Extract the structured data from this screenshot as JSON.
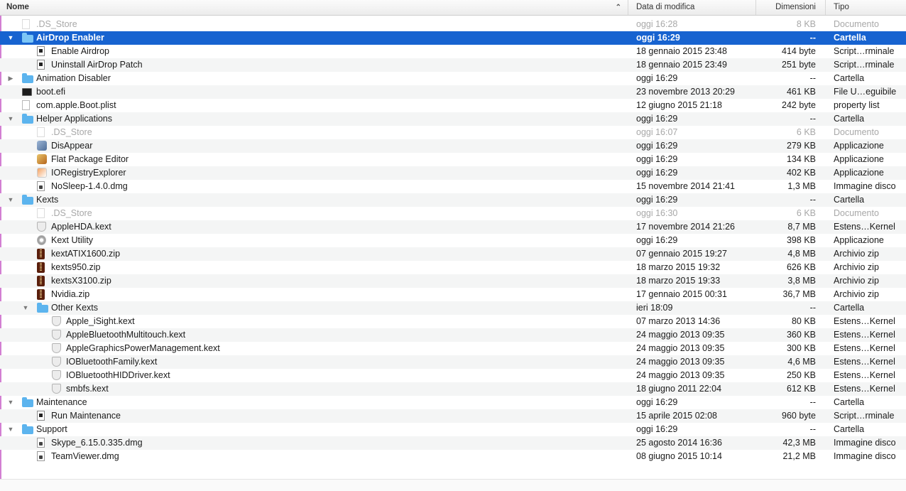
{
  "columns": {
    "name": "Nome",
    "date": "Data di modifica",
    "size": "Dimensioni",
    "kind": "Tipo"
  },
  "rows": [
    {
      "name": ".DS_Store",
      "date": "oggi 16:28",
      "size": "8 KB",
      "kind": "Documento",
      "level": 1,
      "icon": "document-icon",
      "dim": true
    },
    {
      "name": "AirDrop Enabler",
      "date": "oggi 16:29",
      "size": "--",
      "kind": "Cartella",
      "level": 1,
      "icon": "folder-icon",
      "disclosure": "expanded",
      "selected": true
    },
    {
      "name": "Enable Airdrop",
      "date": "18 gennaio 2015 23:48",
      "size": "414 byte",
      "kind": "Script…rminale",
      "level": 2,
      "icon": "script-icon"
    },
    {
      "name": "Uninstall AirDrop Patch",
      "date": "18 gennaio 2015 23:49",
      "size": "251 byte",
      "kind": "Script…rminale",
      "level": 2,
      "icon": "script-icon"
    },
    {
      "name": "Animation Disabler",
      "date": "oggi 16:29",
      "size": "--",
      "kind": "Cartella",
      "level": 1,
      "icon": "folder-icon",
      "disclosure": "collapsed"
    },
    {
      "name": "boot.efi",
      "date": "23 novembre 2013 20:29",
      "size": "461 KB",
      "kind": "File U…eguibile",
      "level": 1,
      "icon": "terminal-icon"
    },
    {
      "name": "com.apple.Boot.plist",
      "date": "12 giugno 2015 21:18",
      "size": "242 byte",
      "kind": "property list",
      "level": 1,
      "icon": "document-icon"
    },
    {
      "name": "Helper Applications",
      "date": "oggi 16:29",
      "size": "--",
      "kind": "Cartella",
      "level": 1,
      "icon": "folder-icon",
      "disclosure": "expanded"
    },
    {
      "name": ".DS_Store",
      "date": "oggi 16:07",
      "size": "6 KB",
      "kind": "Documento",
      "level": 2,
      "icon": "document-icon",
      "dim": true
    },
    {
      "name": "DisAppear",
      "date": "oggi 16:29",
      "size": "279 KB",
      "kind": "Applicazione",
      "level": 2,
      "icon": "app-icon"
    },
    {
      "name": "Flat Package Editor",
      "date": "oggi 16:29",
      "size": "134 KB",
      "kind": "Applicazione",
      "level": 2,
      "icon": "package-app-icon"
    },
    {
      "name": "IORegistryExplorer",
      "date": "oggi 16:29",
      "size": "402 KB",
      "kind": "Applicazione",
      "level": 2,
      "icon": "registry-app-icon"
    },
    {
      "name": "NoSleep-1.4.0.dmg",
      "date": "15 novembre 2014 21:41",
      "size": "1,3 MB",
      "kind": "Immagine disco",
      "level": 2,
      "icon": "disk-image-icon"
    },
    {
      "name": "Kexts",
      "date": "oggi 16:29",
      "size": "--",
      "kind": "Cartella",
      "level": 1,
      "icon": "folder-icon",
      "disclosure": "expanded"
    },
    {
      "name": ".DS_Store",
      "date": "oggi 16:30",
      "size": "6 KB",
      "kind": "Documento",
      "level": 2,
      "icon": "document-icon",
      "dim": true
    },
    {
      "name": "AppleHDA.kext",
      "date": "17 novembre 2014 21:26",
      "size": "8,7 MB",
      "kind": "Estens…Kernel",
      "level": 2,
      "icon": "kext-icon"
    },
    {
      "name": "Kext Utility",
      "date": "oggi 16:29",
      "size": "398 KB",
      "kind": "Applicazione",
      "level": 2,
      "icon": "kext-utility-app-icon"
    },
    {
      "name": "kextATIX1600.zip",
      "date": "07 gennaio 2015 19:27",
      "size": "4,8 MB",
      "kind": "Archivio zip",
      "level": 2,
      "icon": "zip-icon"
    },
    {
      "name": "kexts950.zip",
      "date": "18 marzo 2015 19:32",
      "size": "626 KB",
      "kind": "Archivio zip",
      "level": 2,
      "icon": "zip-icon"
    },
    {
      "name": "kextsX3100.zip",
      "date": "18 marzo 2015 19:33",
      "size": "3,8 MB",
      "kind": "Archivio zip",
      "level": 2,
      "icon": "zip-icon"
    },
    {
      "name": "Nvidia.zip",
      "date": "17 gennaio 2015 00:31",
      "size": "36,7 MB",
      "kind": "Archivio zip",
      "level": 2,
      "icon": "zip-icon"
    },
    {
      "name": "Other Kexts",
      "date": "ieri 18:09",
      "size": "--",
      "kind": "Cartella",
      "level": 2,
      "icon": "folder-icon",
      "disclosure": "expanded"
    },
    {
      "name": "Apple_iSight.kext",
      "date": "07 marzo 2013 14:36",
      "size": "80 KB",
      "kind": "Estens…Kernel",
      "level": 3,
      "icon": "kext-icon"
    },
    {
      "name": "AppleBluetoothMultitouch.kext",
      "date": "24 maggio 2013 09:35",
      "size": "360 KB",
      "kind": "Estens…Kernel",
      "level": 3,
      "icon": "kext-icon"
    },
    {
      "name": "AppleGraphicsPowerManagement.kext",
      "date": "24 maggio 2013 09:35",
      "size": "300 KB",
      "kind": "Estens…Kernel",
      "level": 3,
      "icon": "kext-icon"
    },
    {
      "name": "IOBluetoothFamily.kext",
      "date": "24 maggio 2013 09:35",
      "size": "4,6 MB",
      "kind": "Estens…Kernel",
      "level": 3,
      "icon": "kext-icon"
    },
    {
      "name": "IOBluetoothHIDDriver.kext",
      "date": "24 maggio 2013 09:35",
      "size": "250 KB",
      "kind": "Estens…Kernel",
      "level": 3,
      "icon": "kext-icon"
    },
    {
      "name": "smbfs.kext",
      "date": "18 giugno 2011 22:04",
      "size": "612 KB",
      "kind": "Estens…Kernel",
      "level": 3,
      "icon": "kext-icon"
    },
    {
      "name": "Maintenance",
      "date": "oggi 16:29",
      "size": "--",
      "kind": "Cartella",
      "level": 1,
      "icon": "folder-icon",
      "disclosure": "expanded"
    },
    {
      "name": "Run Maintenance",
      "date": "15 aprile 2015 02:08",
      "size": "960 byte",
      "kind": "Script…rminale",
      "level": 2,
      "icon": "script-icon"
    },
    {
      "name": "Support",
      "date": "oggi 16:29",
      "size": "--",
      "kind": "Cartella",
      "level": 1,
      "icon": "folder-icon",
      "disclosure": "expanded"
    },
    {
      "name": "Skype_6.15.0.335.dmg",
      "date": "25 agosto 2014 16:36",
      "size": "42,3 MB",
      "kind": "Immagine disco",
      "level": 2,
      "icon": "disk-image-icon"
    },
    {
      "name": "TeamViewer.dmg",
      "date": "08 giugno 2015 10:14",
      "size": "21,2 MB",
      "kind": "Immagine disco",
      "level": 2,
      "icon": "disk-image-icon"
    }
  ],
  "colors": {
    "selection": "#1763d0",
    "folder": "#5cb4ee",
    "dim_text": "#a8a8a8"
  }
}
